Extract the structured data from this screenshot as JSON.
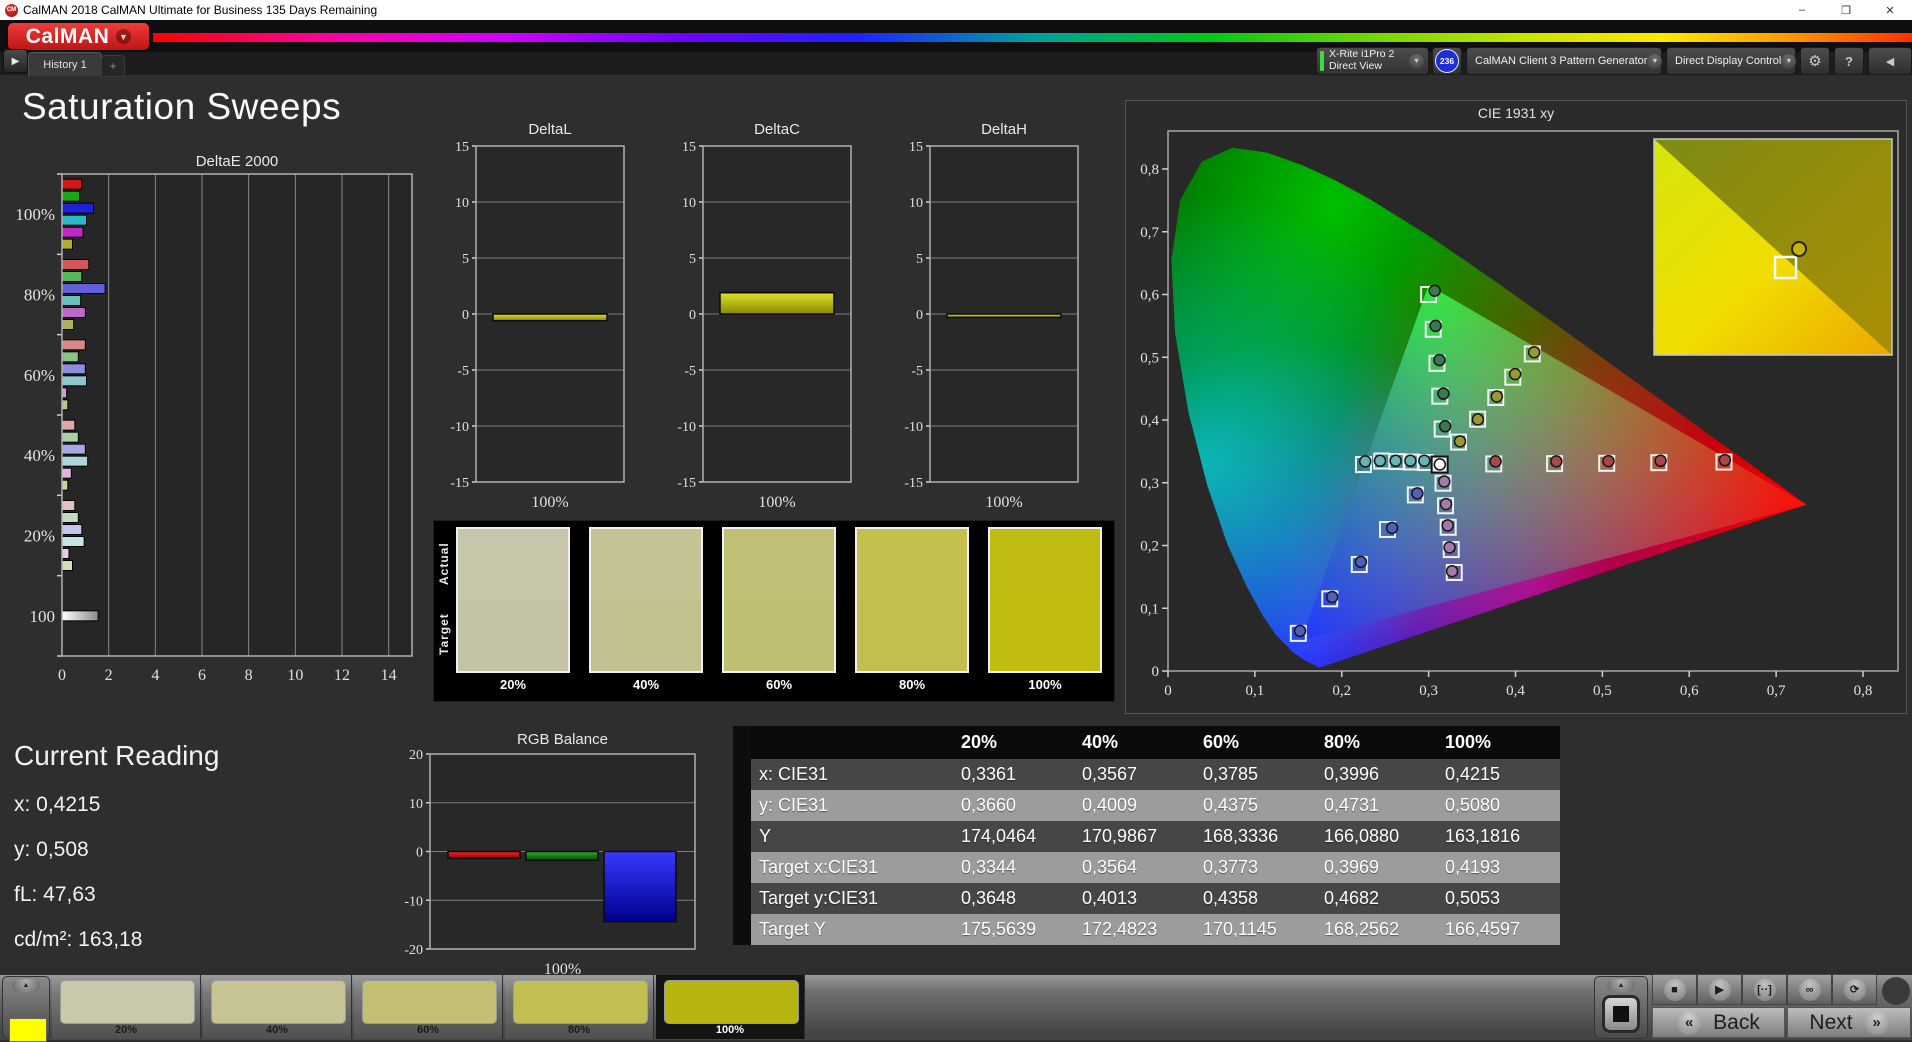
{
  "window": {
    "title": "CalMAN 2018 CalMAN Ultimate for Business 135 Days Remaining",
    "app_icon_text": "CM",
    "controls": {
      "minimize": "–",
      "maximize": "❐",
      "close": "✕"
    }
  },
  "logo": {
    "text": "CalMAN",
    "accent": "#cc1f1f"
  },
  "icons": {
    "chevron_down": "▼",
    "play": "▶",
    "add": "+",
    "gear": "⚙",
    "help": "?",
    "panel_left": "◀",
    "up": "▲",
    "back_chevron": "«",
    "next_chevron": "»"
  },
  "tabs": {
    "history_label": "History 1"
  },
  "toolbar": {
    "meter": {
      "line1": "X-Rite i1Pro 2",
      "line2": "Direct View",
      "accent": "#3ddb3d",
      "badge": "236",
      "badge_color": "#1a2fd8"
    },
    "pattern_generator": {
      "label": "CalMAN Client 3 Pattern Generator",
      "accent": "#3ddb3d"
    },
    "display_control": {
      "label": "Direct Display Control",
      "accent": "#e8e83a"
    }
  },
  "page_title": "Saturation Sweeps",
  "current_reading": {
    "title": "Current Reading",
    "lines": [
      "x: 0,4215",
      "y: 0,508",
      "fL: 47,63",
      "cd/m²: 163,18"
    ]
  },
  "swatch_strip": {
    "row_labels": [
      "Actual",
      "Target"
    ],
    "labels": [
      "20%",
      "40%",
      "60%",
      "80%",
      "100%"
    ],
    "actual": [
      "#c7c6aa",
      "#c5c394",
      "#c1be76",
      "#c3c04e",
      "#bfbb10"
    ],
    "target": [
      "#c4c3a5",
      "#c2c08f",
      "#c0be73",
      "#c2bf4f",
      "#c1bd0e"
    ]
  },
  "bottom_bar": {
    "preview_color": "#ffff00",
    "swatches": [
      {
        "label": "20%",
        "color": "#c9c8ab",
        "selected": false
      },
      {
        "label": "40%",
        "color": "#c6c492",
        "selected": false
      },
      {
        "label": "60%",
        "color": "#c2bf72",
        "selected": false
      },
      {
        "label": "80%",
        "color": "#c2bf52",
        "selected": false
      },
      {
        "label": "100%",
        "color": "#b8b40f",
        "selected": true
      }
    ],
    "transport": [
      "■",
      "▶",
      "[··]",
      "∞",
      "⟳"
    ],
    "back_label": "Back",
    "next_label": "Next"
  },
  "chart_data": [
    {
      "type": "bar",
      "title": "DeltaE 2000",
      "orientation": "horizontal",
      "groups": [
        "100%",
        "80%",
        "60%",
        "40%",
        "20%",
        "100"
      ],
      "series_labels": [
        "red",
        "green",
        "blue",
        "cyan",
        "magenta",
        "yellow"
      ],
      "values": [
        [
          0.85,
          0.75,
          1.35,
          1.05,
          0.9,
          0.45
        ],
        [
          1.15,
          0.85,
          1.85,
          0.8,
          1.0,
          0.5
        ],
        [
          1.0,
          0.7,
          1.0,
          1.05,
          0.2,
          0.25
        ],
        [
          0.55,
          0.7,
          1.0,
          1.1,
          0.4,
          0.25
        ],
        [
          0.55,
          0.7,
          0.85,
          0.95,
          0.3,
          0.45
        ],
        [
          1.55
        ]
      ],
      "colors": [
        [
          "#d01818",
          "#18a818",
          "#2020d8",
          "#28b8c8",
          "#c028c8",
          "#b0b028"
        ],
        [
          "#d05858",
          "#58b858",
          "#6060d8",
          "#68c0c0",
          "#c068c8",
          "#b0b058"
        ],
        [
          "#d88888",
          "#88c488",
          "#8c8ce0",
          "#8cc8cc",
          "#d898dc",
          "#c0c088"
        ],
        [
          "#dca8a8",
          "#a8d0a8",
          "#a8a8e4",
          "#a8d8d8",
          "#e0b4e0",
          "#d0d0a0"
        ],
        [
          "#e4c0c0",
          "#c0dcc0",
          "#c4c4ec",
          "#c4e4e4",
          "#e8cce8",
          "#dcdcb8"
        ],
        [
          "#ffffff"
        ]
      ],
      "xlim": [
        0,
        15
      ],
      "xticks": [
        0,
        2,
        4,
        6,
        8,
        10,
        12,
        14
      ]
    },
    {
      "type": "bar",
      "title": "DeltaL",
      "categories": [
        "100%"
      ],
      "values": [
        -0.6
      ],
      "ylim": [
        -15,
        15
      ],
      "yticks": [
        15,
        10,
        5,
        0,
        -5,
        -10,
        -15
      ],
      "bar_color": "#c8c81a"
    },
    {
      "type": "bar",
      "title": "DeltaC",
      "categories": [
        "100%"
      ],
      "values": [
        1.9
      ],
      "ylim": [
        -15,
        15
      ],
      "yticks": [
        15,
        10,
        5,
        0,
        -5,
        -10,
        -15
      ],
      "bar_color": "#c8c81a"
    },
    {
      "type": "bar",
      "title": "DeltaH",
      "categories": [
        "100%"
      ],
      "values": [
        -0.3
      ],
      "ylim": [
        -15,
        15
      ],
      "yticks": [
        15,
        10,
        5,
        0,
        -5,
        -10,
        -15
      ],
      "bar_color": "#c8c81a"
    },
    {
      "type": "scatter",
      "title": "CIE 1931 xy",
      "xlim": [
        0,
        0.8
      ],
      "ylim": [
        0,
        0.8
      ],
      "xtick_labels": [
        "0",
        "0,1",
        "0,2",
        "0,3",
        "0,4",
        "0,5",
        "0,6",
        "0,7",
        "0,8"
      ],
      "ytick_labels": [
        "0",
        "0,1",
        "0,2",
        "0,3",
        "0,4",
        "0,5",
        "0,6",
        "0,7",
        "0,8"
      ],
      "white_point": {
        "target": [
          0.3127,
          0.329
        ],
        "measured": [
          0.3129,
          0.3292
        ]
      },
      "gamut_triangle": [
        [
          0.3,
          0.615
        ],
        [
          0.735,
          0.265
        ],
        [
          0.153,
          0.048
        ]
      ],
      "sweeps": [
        {
          "name": "red",
          "circle_color": "#a84848",
          "targets": [
            [
              0.375,
              0.33
            ],
            [
              0.445,
              0.3305
            ],
            [
              0.505,
              0.331
            ],
            [
              0.565,
              0.332
            ],
            [
              0.64,
              0.333
            ]
          ],
          "measured": [
            [
              0.377,
              0.334
            ],
            [
              0.447,
              0.334
            ],
            [
              0.507,
              0.3345
            ],
            [
              0.567,
              0.335
            ],
            [
              0.641,
              0.336
            ]
          ]
        },
        {
          "name": "green",
          "circle_color": "#3c7850",
          "targets": [
            [
              0.3156,
              0.3856
            ],
            [
              0.3129,
              0.438
            ],
            [
              0.3096,
              0.4903
            ],
            [
              0.3053,
              0.5445
            ],
            [
              0.3,
              0.6
            ]
          ],
          "measured": [
            [
              0.319,
              0.39
            ],
            [
              0.317,
              0.442
            ],
            [
              0.3125,
              0.4955
            ],
            [
              0.308,
              0.55
            ],
            [
              0.307,
              0.606
            ]
          ]
        },
        {
          "name": "blue",
          "circle_color": "#5060b8",
          "targets": [
            [
              0.2847,
              0.2806
            ],
            [
              0.2527,
              0.2255
            ],
            [
              0.2202,
              0.1697
            ],
            [
              0.1862,
              0.1151
            ],
            [
              0.15,
              0.06
            ]
          ],
          "measured": [
            [
              0.287,
              0.283
            ],
            [
              0.258,
              0.228
            ],
            [
              0.222,
              0.174
            ],
            [
              0.189,
              0.118
            ],
            [
              0.152,
              0.064
            ]
          ]
        },
        {
          "name": "cyan",
          "circle_color": "#68b4b4",
          "targets": [
            [
              0.2962,
              0.3322
            ],
            [
              0.28,
              0.333
            ],
            [
              0.2636,
              0.3338
            ],
            [
              0.246,
              0.3346
            ],
            [
              0.225,
              0.329
            ]
          ],
          "measured": [
            [
              0.295,
              0.335
            ],
            [
              0.279,
              0.335
            ],
            [
              0.262,
              0.335
            ],
            [
              0.244,
              0.335
            ],
            [
              0.227,
              0.334
            ]
          ]
        },
        {
          "name": "magenta",
          "circle_color": "#a878a8",
          "targets": [
            [
              0.3166,
              0.2993
            ],
            [
              0.3195,
              0.2633
            ],
            [
              0.3225,
              0.2291
            ],
            [
              0.326,
              0.1935
            ],
            [
              0.3295,
              0.157
            ]
          ],
          "measured": [
            [
              0.318,
              0.302
            ],
            [
              0.32,
              0.266
            ],
            [
              0.322,
              0.232
            ],
            [
              0.324,
              0.197
            ],
            [
              0.327,
              0.159
            ]
          ]
        },
        {
          "name": "yellow",
          "circle_color": "#9a9a30",
          "targets": [
            [
              0.3344,
              0.3648
            ],
            [
              0.3564,
              0.4013
            ],
            [
              0.3773,
              0.4358
            ],
            [
              0.3969,
              0.4682
            ],
            [
              0.4193,
              0.5053
            ]
          ],
          "measured": [
            [
              0.3361,
              0.366
            ],
            [
              0.3567,
              0.4009
            ],
            [
              0.3785,
              0.4375
            ],
            [
              0.3996,
              0.4731
            ],
            [
              0.4215,
              0.508
            ]
          ]
        }
      ],
      "inset": {
        "target": [
          0.4193,
          0.5053
        ],
        "measured": [
          0.4215,
          0.508
        ]
      }
    },
    {
      "type": "bar",
      "title": "RGB Balance",
      "categories": [
        "Red",
        "Green",
        "Blue"
      ],
      "values": [
        -1.4,
        -1.8,
        -14.4
      ],
      "colors": [
        "#e01414",
        "#18a018",
        "#1818e8"
      ],
      "ylim": [
        -20,
        20
      ],
      "yticks": [
        20,
        10,
        0,
        -10,
        -20
      ],
      "xlabel": "100%"
    },
    {
      "type": "table",
      "columns": [
        "",
        "20%",
        "40%",
        "60%",
        "80%",
        "100%"
      ],
      "rows": [
        {
          "label": "x: CIE31",
          "values": [
            "0,3361",
            "0,3567",
            "0,3785",
            "0,3996",
            "0,4215"
          ]
        },
        {
          "label": "y: CIE31",
          "values": [
            "0,3660",
            "0,4009",
            "0,4375",
            "0,4731",
            "0,5080"
          ]
        },
        {
          "label": "Y",
          "values": [
            "174,0464",
            "170,9867",
            "168,3336",
            "166,0880",
            "163,1816"
          ]
        },
        {
          "label": "Target x:CIE31",
          "values": [
            "0,3344",
            "0,3564",
            "0,3773",
            "0,3969",
            "0,4193"
          ]
        },
        {
          "label": "Target y:CIE31",
          "values": [
            "0,3648",
            "0,4013",
            "0,4358",
            "0,4682",
            "0,5053"
          ]
        },
        {
          "label": "Target Y",
          "values": [
            "175,5639",
            "172,4823",
            "170,1145",
            "168,2562",
            "166,4597"
          ]
        }
      ]
    }
  ]
}
